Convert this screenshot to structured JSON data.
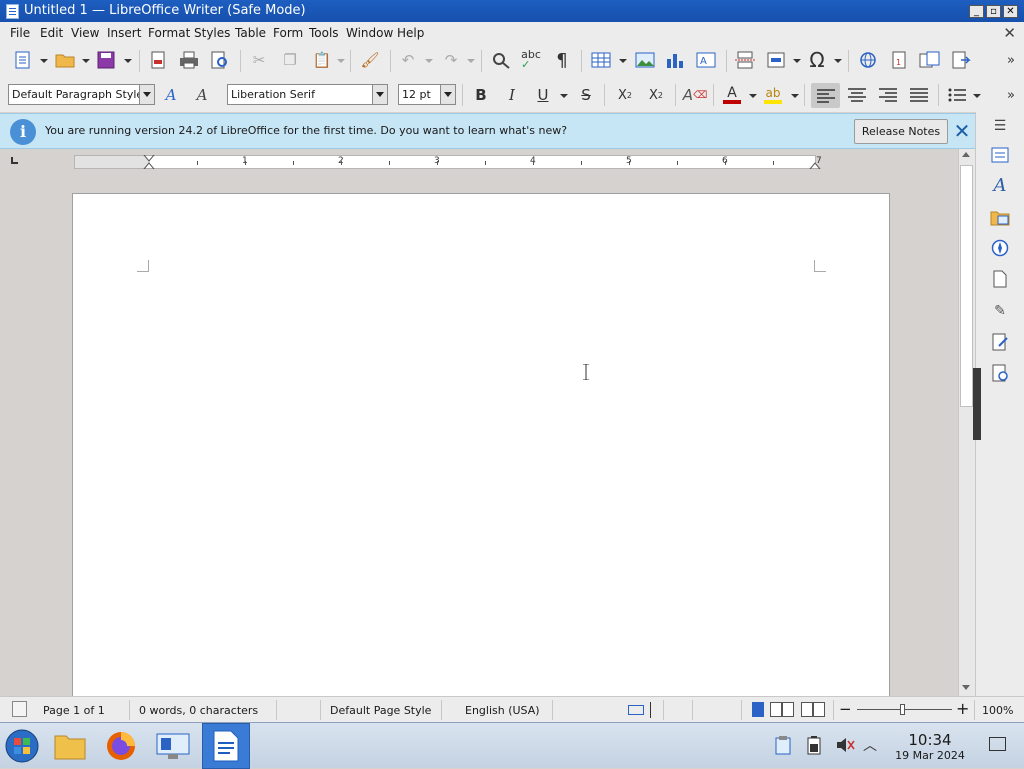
{
  "window": {
    "title": "Untitled 1 — LibreOffice Writer (Safe Mode)"
  },
  "menu": [
    "File",
    "Edit",
    "View",
    "Insert",
    "Format",
    "Styles",
    "Table",
    "Form",
    "Tools",
    "Window",
    "Help"
  ],
  "formatting": {
    "paragraph_style": "Default Paragraph Style",
    "font_name": "Liberation Serif",
    "font_size": "12 pt"
  },
  "infobar": {
    "message": "You are running version 24.2 of LibreOffice for the first time. Do you want to learn what's new?",
    "button": "Release Notes"
  },
  "ruler": {
    "numbers": [
      "1",
      "2",
      "3",
      "4",
      "5",
      "6",
      "7"
    ]
  },
  "status": {
    "page": "Page 1 of 1",
    "words": "0 words, 0 characters",
    "page_style": "Default Page Style",
    "language": "English (USA)",
    "zoom": "100%"
  },
  "taskbar": {
    "time": "10:34",
    "date": "19 Mar 2024"
  },
  "colors": {
    "accent": "#1d5ec0",
    "infobar": "#c6e5f5",
    "font_color": "#c00000",
    "highlight": "#ffe600"
  }
}
